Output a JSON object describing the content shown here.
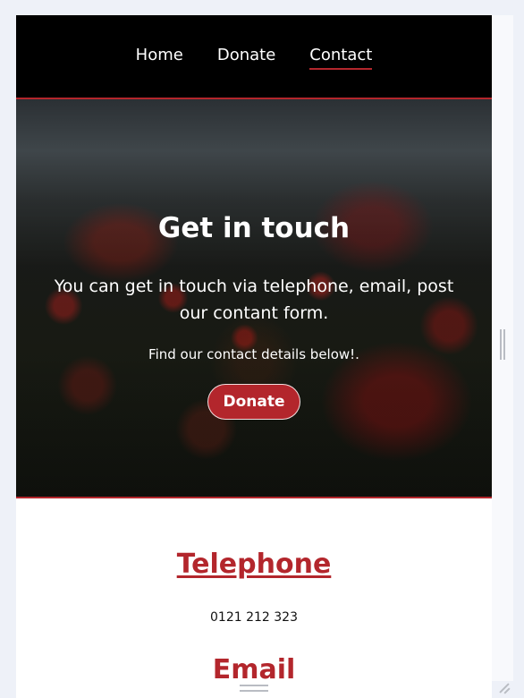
{
  "nav": {
    "items": [
      {
        "label": "Home",
        "active": false
      },
      {
        "label": "Donate",
        "active": false
      },
      {
        "label": "Contact",
        "active": true
      }
    ]
  },
  "hero": {
    "title": "Get in touch",
    "subtitle": "You can get in touch via telephone, email, post our contant form.",
    "note": "Find our contact details below!.",
    "button_label": "Donate"
  },
  "contact": {
    "telephone_heading": "Telephone",
    "telephone_value": "0121 212 323",
    "email_heading": "Email"
  },
  "colors": {
    "accent": "#b3262c",
    "nav_background": "#000000",
    "page_background": "#ffffff"
  }
}
